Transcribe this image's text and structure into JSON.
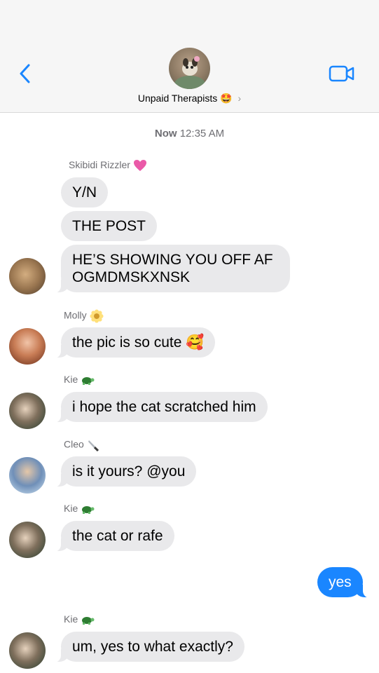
{
  "header": {
    "group_name": "Unpaid Therapists",
    "group_emoji": "🤩",
    "chevron": "›"
  },
  "timestamp": {
    "day": "Now",
    "time": "12:35 AM"
  },
  "messages": [
    {
      "sender": "Skibidi Rizzler",
      "sender_emoji": "heart-icon",
      "text": "Y/N"
    },
    {
      "text": "THE POST"
    },
    {
      "text_line1": "HE’S SHOWING YOU OFF AF",
      "text_line2": "OGMDMSKXNSK"
    },
    {
      "sender": "Molly",
      "sender_emoji": "flower-icon",
      "text": "the pic is so cute",
      "text_emoji": "🥰"
    },
    {
      "sender": "Kie",
      "sender_emoji": "turtle-icon",
      "text": "i hope the cat scratched him"
    },
    {
      "sender": "Cleo",
      "sender_emoji": "knife-icon",
      "text": "is it yours? @you"
    },
    {
      "sender": "Kie",
      "sender_emoji": "turtle-icon",
      "text": "the cat or rafe"
    },
    {
      "outgoing": true,
      "text": "yes"
    },
    {
      "sender": "Kie",
      "sender_emoji": "turtle-icon",
      "text": "um, yes to what exactly?"
    }
  ],
  "colors": {
    "incoming_bubble": "#e9e9eb",
    "outgoing_bubble": "#1a86ff",
    "accent": "#1a86ff",
    "meta_text": "#6e6e73"
  }
}
